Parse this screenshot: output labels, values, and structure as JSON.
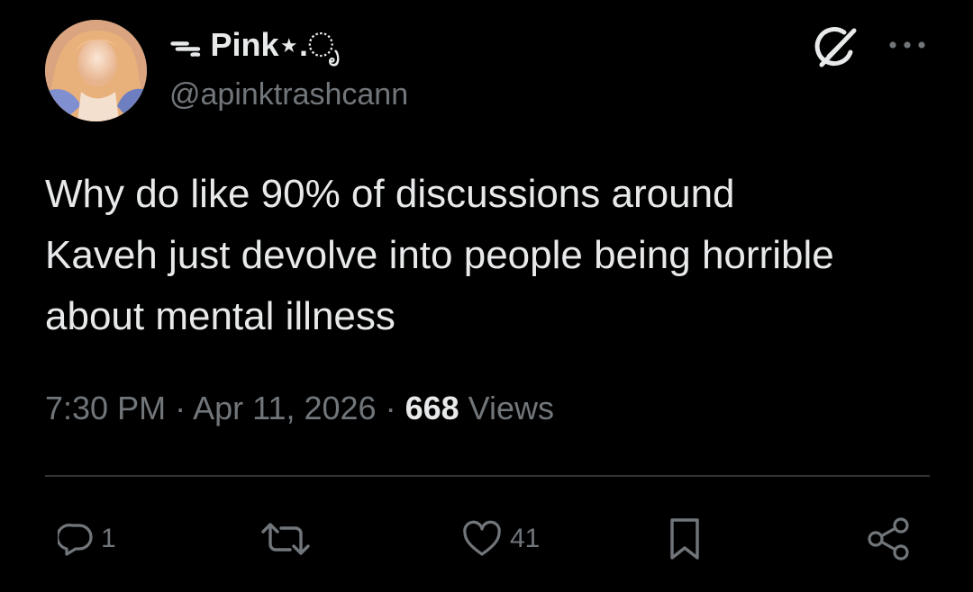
{
  "author": {
    "display_name": "ᯓ Pink⋆.ೃ",
    "handle": "@apinktrashcann",
    "avatar_icon": "anime-avatar"
  },
  "header_icons": {
    "grok": "grok-icon",
    "more": "more-horizontal-icon"
  },
  "tweet": {
    "text": "Why do like 90% of discussions around\nKaveh just devolve into people being horrible\nabout mental illness"
  },
  "meta": {
    "time": "7:30 PM",
    "separator1": " · ",
    "date": "Apr 11, 2026",
    "separator2": " · ",
    "views_count": "668",
    "views_label": " Views"
  },
  "actions": {
    "reply_count": "1",
    "repost_count": "",
    "like_count": "41"
  },
  "colors": {
    "background": "#000000",
    "text_primary": "#e7e9ea",
    "text_secondary": "#71767b",
    "divider": "#2f3336"
  }
}
